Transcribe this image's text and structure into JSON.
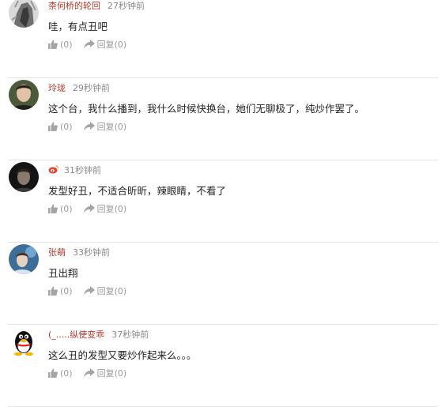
{
  "comments": [
    {
      "username": "柰何桥的轮回",
      "time": "27秒钟前",
      "text": "哇，有点丑吧",
      "like_count": "(0)",
      "reply_label": "回复(0)",
      "avatar_icon": "sketch-portrait-icon"
    },
    {
      "username": "玲珑",
      "time": "29秒钟前",
      "text": "这个台，我什么播到，我什么时候快换台，她们无聊极了，纯炒作罢了。",
      "like_count": "(0)",
      "reply_label": "回复(0)",
      "avatar_icon": "man-photo-icon"
    },
    {
      "username": "",
      "time": "31秒钟前",
      "text": "发型好丑，不适合昕昕，辣眼睛，不看了",
      "like_count": "(0)",
      "reply_label": "回复(0)",
      "avatar_icon": "dark-portrait-icon",
      "username_icon": "weibo-icon"
    },
    {
      "username": "张萌",
      "time": "33秒钟前",
      "text": "丑出翔",
      "like_count": "(0)",
      "reply_label": "回复(0)",
      "avatar_icon": "blue-portrait-icon"
    },
    {
      "username": "(_.....纵使变乖",
      "time": "37秒钟前",
      "text": "这么丑的发型又要炒作起来么。。。",
      "like_count": "(0)",
      "reply_label": "回复(0)",
      "avatar_icon": "qq-penguin-icon"
    }
  ],
  "colors": {
    "username": "#b3372b",
    "time": "#888888",
    "text": "#222222",
    "action": "#9a9a9a",
    "divider": "#e3e3e3"
  }
}
